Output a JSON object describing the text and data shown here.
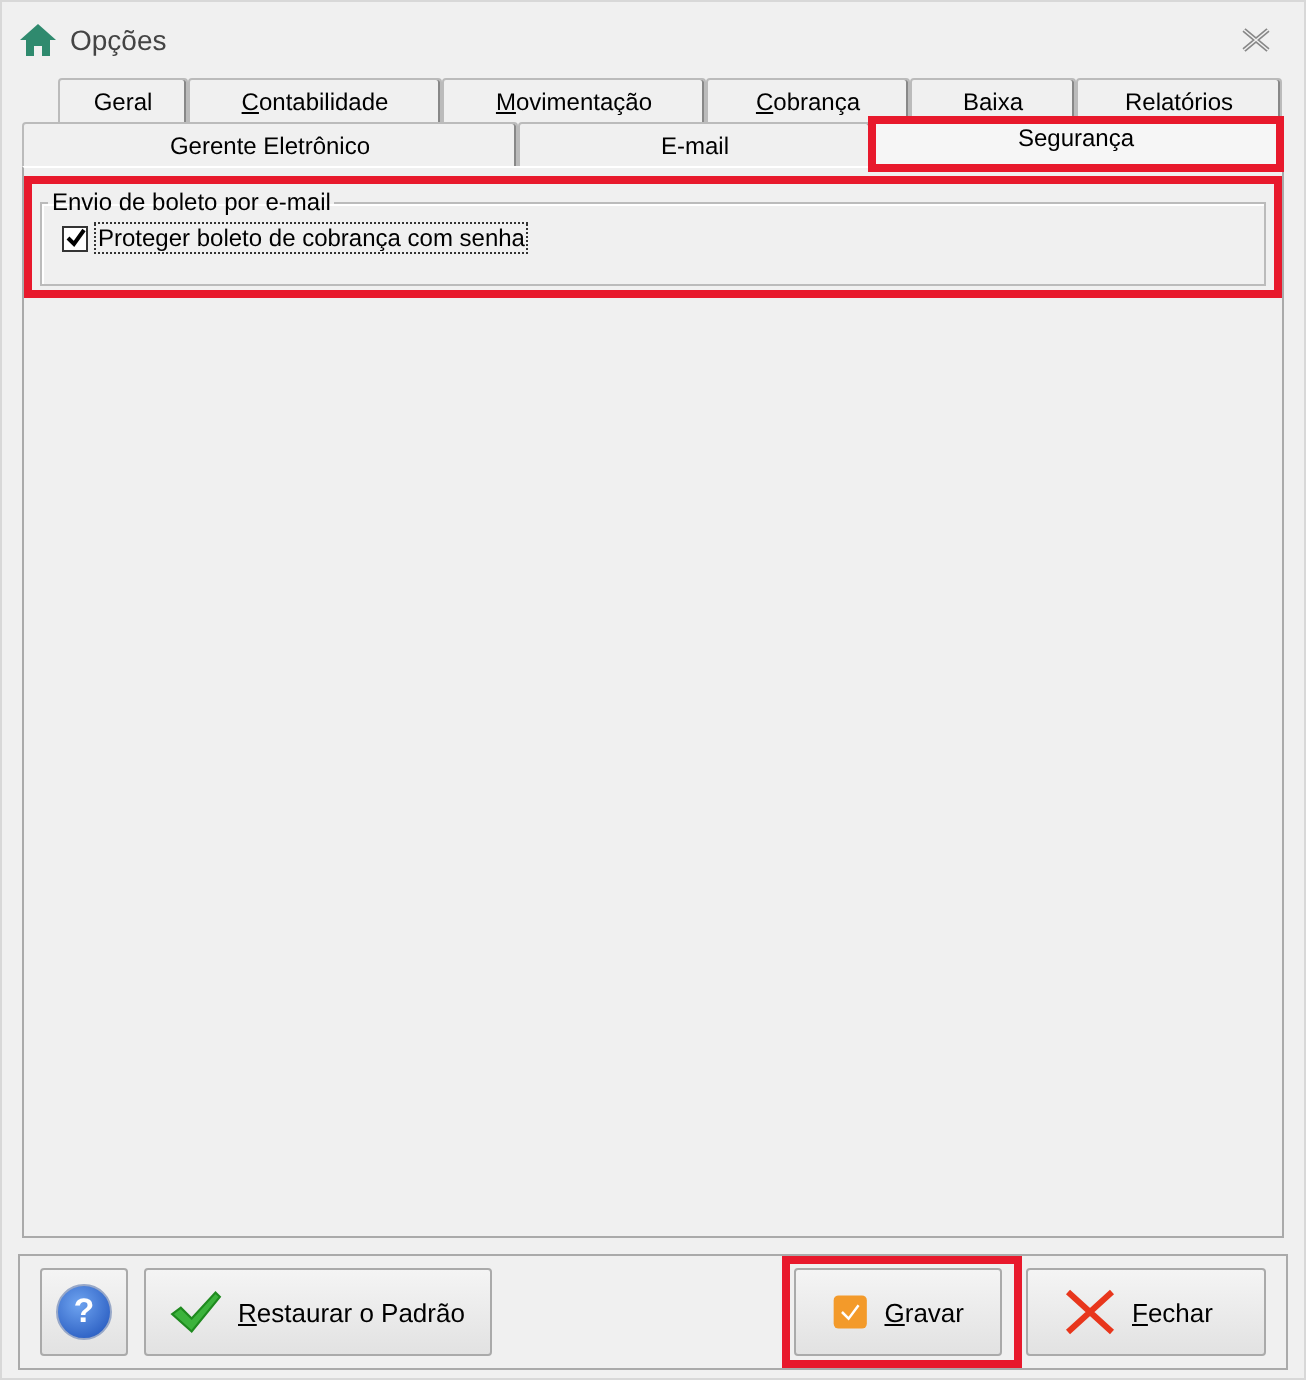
{
  "window": {
    "title": "Opções"
  },
  "tab_rows": [
    {
      "tabs": [
        {
          "label": "Geral",
          "selected": false,
          "underline_first": false,
          "highlighted": false
        },
        {
          "label": "Contabilidade",
          "selected": false,
          "underline_first": true,
          "highlighted": false
        },
        {
          "label": "Movimentação",
          "selected": false,
          "underline_first": true,
          "highlighted": false
        },
        {
          "label": "Cobrança",
          "selected": false,
          "underline_first": true,
          "highlighted": false
        },
        {
          "label": "Baixa",
          "selected": false,
          "underline_first": false,
          "highlighted": false
        },
        {
          "label": "Relatórios",
          "selected": false,
          "underline_first": false,
          "highlighted": false
        }
      ]
    },
    {
      "tabs": [
        {
          "label": "Gerente Eletrônico",
          "selected": false,
          "underline_first": false,
          "highlighted": false
        },
        {
          "label": "E-mail",
          "selected": false,
          "underline_first": false,
          "highlighted": false
        },
        {
          "label": "Segurança",
          "selected": true,
          "underline_first": false,
          "highlighted": true
        }
      ]
    }
  ],
  "group": {
    "title": "Envio de boleto por e-mail",
    "highlighted": true,
    "checkbox": {
      "label": "Proteger boleto de cobrança com senha",
      "checked": true
    }
  },
  "help_button": {
    "glyph": "?"
  },
  "buttons": [
    {
      "kind": "restore",
      "label": "Restaurar o Padrão",
      "underline_first": true,
      "highlighted": false
    },
    {
      "kind": "save",
      "label": "Gravar",
      "underline_first": true,
      "highlighted": true
    },
    {
      "kind": "close",
      "label": "Fechar",
      "underline_first": true,
      "highlighted": false
    }
  ]
}
